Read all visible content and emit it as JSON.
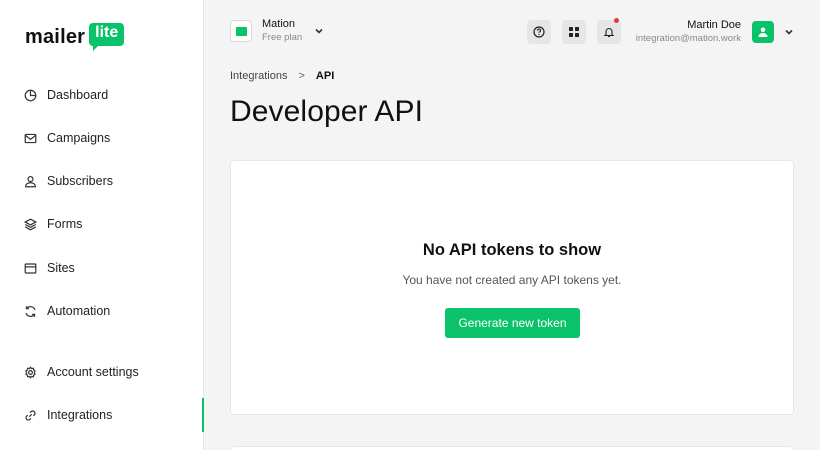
{
  "brand": {
    "logo_text": "mailer",
    "logo_badge": "lite",
    "accent": "#09c269"
  },
  "sidebar": {
    "items": [
      {
        "label": "Dashboard",
        "icon": "dashboard-icon"
      },
      {
        "label": "Campaigns",
        "icon": "mail-icon"
      },
      {
        "label": "Subscribers",
        "icon": "user-icon"
      },
      {
        "label": "Forms",
        "icon": "layers-icon"
      },
      {
        "label": "Sites",
        "icon": "browser-icon"
      },
      {
        "label": "Automation",
        "icon": "refresh-icon"
      },
      {
        "label": "Account settings",
        "icon": "gear-icon"
      },
      {
        "label": "Integrations",
        "icon": "link-icon",
        "active": true
      }
    ]
  },
  "topbar": {
    "workspace_name": "Mation",
    "workspace_plan": "Free plan",
    "user_name": "Martin Doe",
    "user_email": "integration@mation.work",
    "notification_dot_color": "#e53935"
  },
  "breadcrumb": {
    "parent": "Integrations",
    "separator": ">",
    "current": "API"
  },
  "page": {
    "title": "Developer API",
    "empty_title": "No API tokens to show",
    "empty_description": "You have not created any API tokens yet.",
    "generate_button": "Generate new token"
  }
}
